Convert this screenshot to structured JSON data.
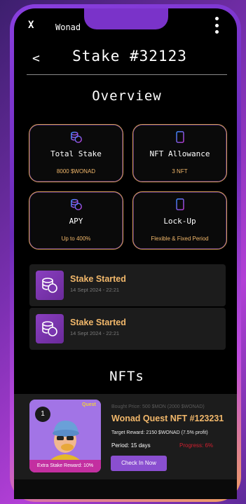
{
  "system": {
    "close_glyph": "X",
    "app_name": "Wonad"
  },
  "header": {
    "back_glyph": "<",
    "title": "Stake #32123"
  },
  "overview": {
    "title": "Overview",
    "cards": [
      {
        "icon": "coin-stack-icon",
        "label": "Total Stake",
        "value": "8000 $WONAD"
      },
      {
        "icon": "phone-icon",
        "label": "NFT Allowance",
        "value": "3 NFT"
      },
      {
        "icon": "coin-stack-icon",
        "label": "APY",
        "value": "Up to 400%"
      },
      {
        "icon": "phone-icon",
        "label": "Lock-Up",
        "value": "Flexible & Fixed Period"
      }
    ]
  },
  "events": [
    {
      "icon": "coin-stack-icon",
      "title": "Stake Started",
      "time": "14 Sept 2024 - 22:21"
    },
    {
      "icon": "coin-stack-icon",
      "title": "Stake Started",
      "time": "14 Sept 2024 - 22:21"
    }
  ],
  "nfts": {
    "title": "NFTs",
    "items": [
      {
        "number": "1",
        "logo": "Quest",
        "extra_reward": "Extra Stake Reward: 10%",
        "bought_price": "Bought Price: 500 $MON (2000 $WONAD)",
        "name": "Wonad Quest  NFT #123231",
        "target_reward": "Target Reward:  2150 $WONAD (7.5% profit)",
        "period": "Period: 15 days",
        "progress": "Progress: 6%",
        "button": "Check In Now"
      }
    ]
  },
  "colors": {
    "accent": "#f2b86b",
    "button": "#8a4fd0",
    "progress": "#d21f2f",
    "card_border": "#d9a054"
  }
}
